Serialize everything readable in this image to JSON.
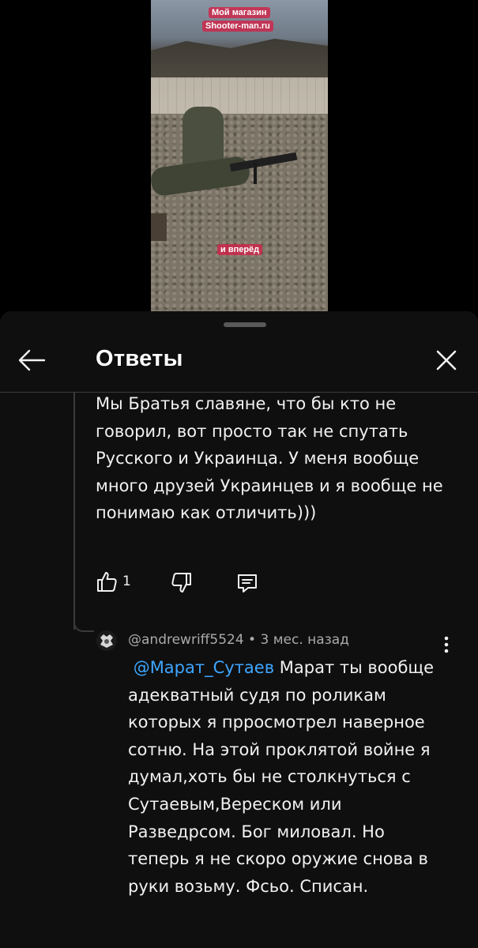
{
  "video": {
    "overlay_top_1": "Мой магазин",
    "overlay_top_2": "Shooter-man.ru",
    "overlay_bottom": "и вперёд"
  },
  "header": {
    "title": "Ответы",
    "back_icon": "arrow-left-icon",
    "close_icon": "close-icon"
  },
  "parent_comment": {
    "text": "Мы Братья славяне, что бы кто не говорил, вот просто так не спутать Русского и Украинца. У меня вообще много друзей Украинцев и я вообще не понимаю как отличить)))",
    "like_count": "1"
  },
  "reply": {
    "author": "@andrewriff5524",
    "separator": " • ",
    "time": "3 мес. назад",
    "mention": "@Марат_Сутаев",
    "text": " Марат ты вообще адекватный судя по роликам которых я прросмотрел наверное сотню. На этой проклятой войне я думал,хоть бы не столкнуться с Сутаевым,Вереском или Разведрсом. Бог миловал. Но теперь я не скоро оружие снова в руки возьму. Фсьо. Списан."
  },
  "colors": {
    "background": "#0f0f0f",
    "text": "#f1f1f1",
    "secondary": "#aaaaaa",
    "mention": "#3ea6ff"
  }
}
